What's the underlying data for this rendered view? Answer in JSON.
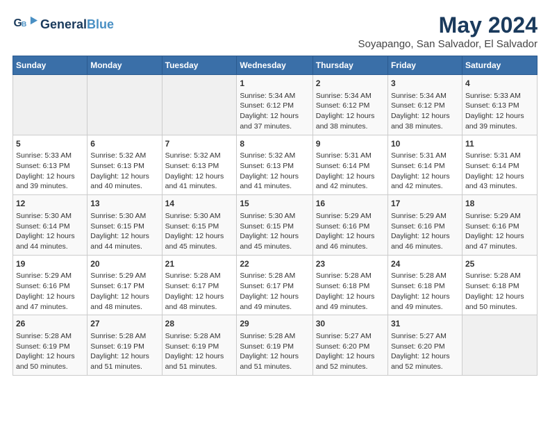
{
  "header": {
    "title": "May 2024",
    "subtitle": "Soyapango, San Salvador, El Salvador"
  },
  "columns": [
    "Sunday",
    "Monday",
    "Tuesday",
    "Wednesday",
    "Thursday",
    "Friday",
    "Saturday"
  ],
  "weeks": [
    [
      {
        "day": "",
        "info": ""
      },
      {
        "day": "",
        "info": ""
      },
      {
        "day": "",
        "info": ""
      },
      {
        "day": "1",
        "info": "Sunrise: 5:34 AM\nSunset: 6:12 PM\nDaylight: 12 hours\nand 37 minutes."
      },
      {
        "day": "2",
        "info": "Sunrise: 5:34 AM\nSunset: 6:12 PM\nDaylight: 12 hours\nand 38 minutes."
      },
      {
        "day": "3",
        "info": "Sunrise: 5:34 AM\nSunset: 6:12 PM\nDaylight: 12 hours\nand 38 minutes."
      },
      {
        "day": "4",
        "info": "Sunrise: 5:33 AM\nSunset: 6:13 PM\nDaylight: 12 hours\nand 39 minutes."
      }
    ],
    [
      {
        "day": "5",
        "info": "Sunrise: 5:33 AM\nSunset: 6:13 PM\nDaylight: 12 hours\nand 39 minutes."
      },
      {
        "day": "6",
        "info": "Sunrise: 5:32 AM\nSunset: 6:13 PM\nDaylight: 12 hours\nand 40 minutes."
      },
      {
        "day": "7",
        "info": "Sunrise: 5:32 AM\nSunset: 6:13 PM\nDaylight: 12 hours\nand 41 minutes."
      },
      {
        "day": "8",
        "info": "Sunrise: 5:32 AM\nSunset: 6:13 PM\nDaylight: 12 hours\nand 41 minutes."
      },
      {
        "day": "9",
        "info": "Sunrise: 5:31 AM\nSunset: 6:14 PM\nDaylight: 12 hours\nand 42 minutes."
      },
      {
        "day": "10",
        "info": "Sunrise: 5:31 AM\nSunset: 6:14 PM\nDaylight: 12 hours\nand 42 minutes."
      },
      {
        "day": "11",
        "info": "Sunrise: 5:31 AM\nSunset: 6:14 PM\nDaylight: 12 hours\nand 43 minutes."
      }
    ],
    [
      {
        "day": "12",
        "info": "Sunrise: 5:30 AM\nSunset: 6:14 PM\nDaylight: 12 hours\nand 44 minutes."
      },
      {
        "day": "13",
        "info": "Sunrise: 5:30 AM\nSunset: 6:15 PM\nDaylight: 12 hours\nand 44 minutes."
      },
      {
        "day": "14",
        "info": "Sunrise: 5:30 AM\nSunset: 6:15 PM\nDaylight: 12 hours\nand 45 minutes."
      },
      {
        "day": "15",
        "info": "Sunrise: 5:30 AM\nSunset: 6:15 PM\nDaylight: 12 hours\nand 45 minutes."
      },
      {
        "day": "16",
        "info": "Sunrise: 5:29 AM\nSunset: 6:16 PM\nDaylight: 12 hours\nand 46 minutes."
      },
      {
        "day": "17",
        "info": "Sunrise: 5:29 AM\nSunset: 6:16 PM\nDaylight: 12 hours\nand 46 minutes."
      },
      {
        "day": "18",
        "info": "Sunrise: 5:29 AM\nSunset: 6:16 PM\nDaylight: 12 hours\nand 47 minutes."
      }
    ],
    [
      {
        "day": "19",
        "info": "Sunrise: 5:29 AM\nSunset: 6:16 PM\nDaylight: 12 hours\nand 47 minutes."
      },
      {
        "day": "20",
        "info": "Sunrise: 5:29 AM\nSunset: 6:17 PM\nDaylight: 12 hours\nand 48 minutes."
      },
      {
        "day": "21",
        "info": "Sunrise: 5:28 AM\nSunset: 6:17 PM\nDaylight: 12 hours\nand 48 minutes."
      },
      {
        "day": "22",
        "info": "Sunrise: 5:28 AM\nSunset: 6:17 PM\nDaylight: 12 hours\nand 49 minutes."
      },
      {
        "day": "23",
        "info": "Sunrise: 5:28 AM\nSunset: 6:18 PM\nDaylight: 12 hours\nand 49 minutes."
      },
      {
        "day": "24",
        "info": "Sunrise: 5:28 AM\nSunset: 6:18 PM\nDaylight: 12 hours\nand 49 minutes."
      },
      {
        "day": "25",
        "info": "Sunrise: 5:28 AM\nSunset: 6:18 PM\nDaylight: 12 hours\nand 50 minutes."
      }
    ],
    [
      {
        "day": "26",
        "info": "Sunrise: 5:28 AM\nSunset: 6:19 PM\nDaylight: 12 hours\nand 50 minutes."
      },
      {
        "day": "27",
        "info": "Sunrise: 5:28 AM\nSunset: 6:19 PM\nDaylight: 12 hours\nand 51 minutes."
      },
      {
        "day": "28",
        "info": "Sunrise: 5:28 AM\nSunset: 6:19 PM\nDaylight: 12 hours\nand 51 minutes."
      },
      {
        "day": "29",
        "info": "Sunrise: 5:28 AM\nSunset: 6:19 PM\nDaylight: 12 hours\nand 51 minutes."
      },
      {
        "day": "30",
        "info": "Sunrise: 5:27 AM\nSunset: 6:20 PM\nDaylight: 12 hours\nand 52 minutes."
      },
      {
        "day": "31",
        "info": "Sunrise: 5:27 AM\nSunset: 6:20 PM\nDaylight: 12 hours\nand 52 minutes."
      },
      {
        "day": "",
        "info": ""
      }
    ]
  ]
}
